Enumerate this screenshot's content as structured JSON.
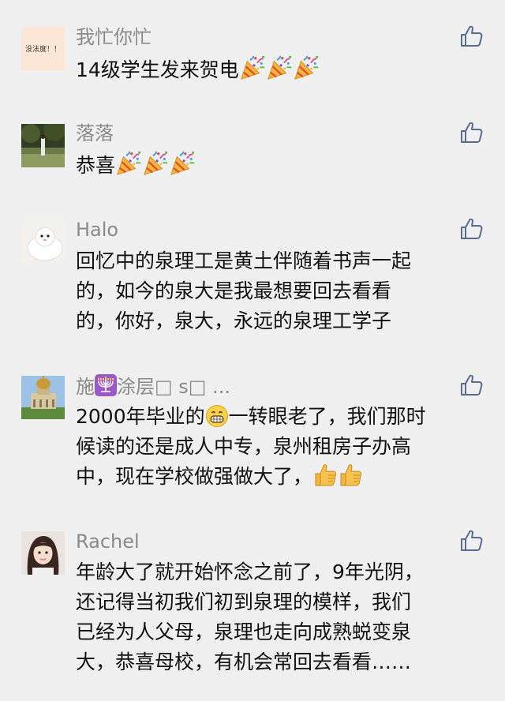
{
  "comments": [
    {
      "author": "我忙你忙",
      "avatar_text": "没法度！！",
      "text_before": "14级学生发来贺电",
      "emoji": "party-popper",
      "emoji_count": 3
    },
    {
      "author": "落落",
      "avatar_image": "person-in-park",
      "text_before": "恭喜",
      "emoji": "party-popper",
      "emoji_count": 3
    },
    {
      "author": "Halo",
      "avatar_image": "white-plush-toy",
      "lines": [
        "回忆中的泉理工是黄土伴随着书声一起",
        "的，如今的泉大是我最想要回去看看",
        "的，你好，泉大，永远的泉理工学子"
      ]
    },
    {
      "author_prefix": "施",
      "author_suffix": "涂层□ s□ ...",
      "author_emoji": "menorah",
      "avatar_image": "cathedral",
      "line1_a": "2000年毕业的",
      "line1_b": "一转眼老了，我们那时",
      "line2": "候读的还是成人中专，泉州租房子办高",
      "line3": "中，现在学校做强做大了，",
      "line1_emoji": "grinning-face",
      "line3_emoji": "thumbs-up",
      "line3_emoji_count": 2
    },
    {
      "author": "Rachel",
      "avatar_image": "young-woman-portrait",
      "lines": [
        "年龄大了就开始怀念之前了，9年光阴，",
        "还记得当初我们初到泉理的模样，我们",
        "已经为人父母，泉理也走向成熟蜕变泉",
        "大，恭喜母校，有机会常回去看看……"
      ]
    }
  ],
  "like_icon": "thumbs-up-outline-icon",
  "colors": {
    "background": "#f0f0f0",
    "name": "#8a8a8a",
    "text": "#111111",
    "like_icon": "#576b95"
  }
}
